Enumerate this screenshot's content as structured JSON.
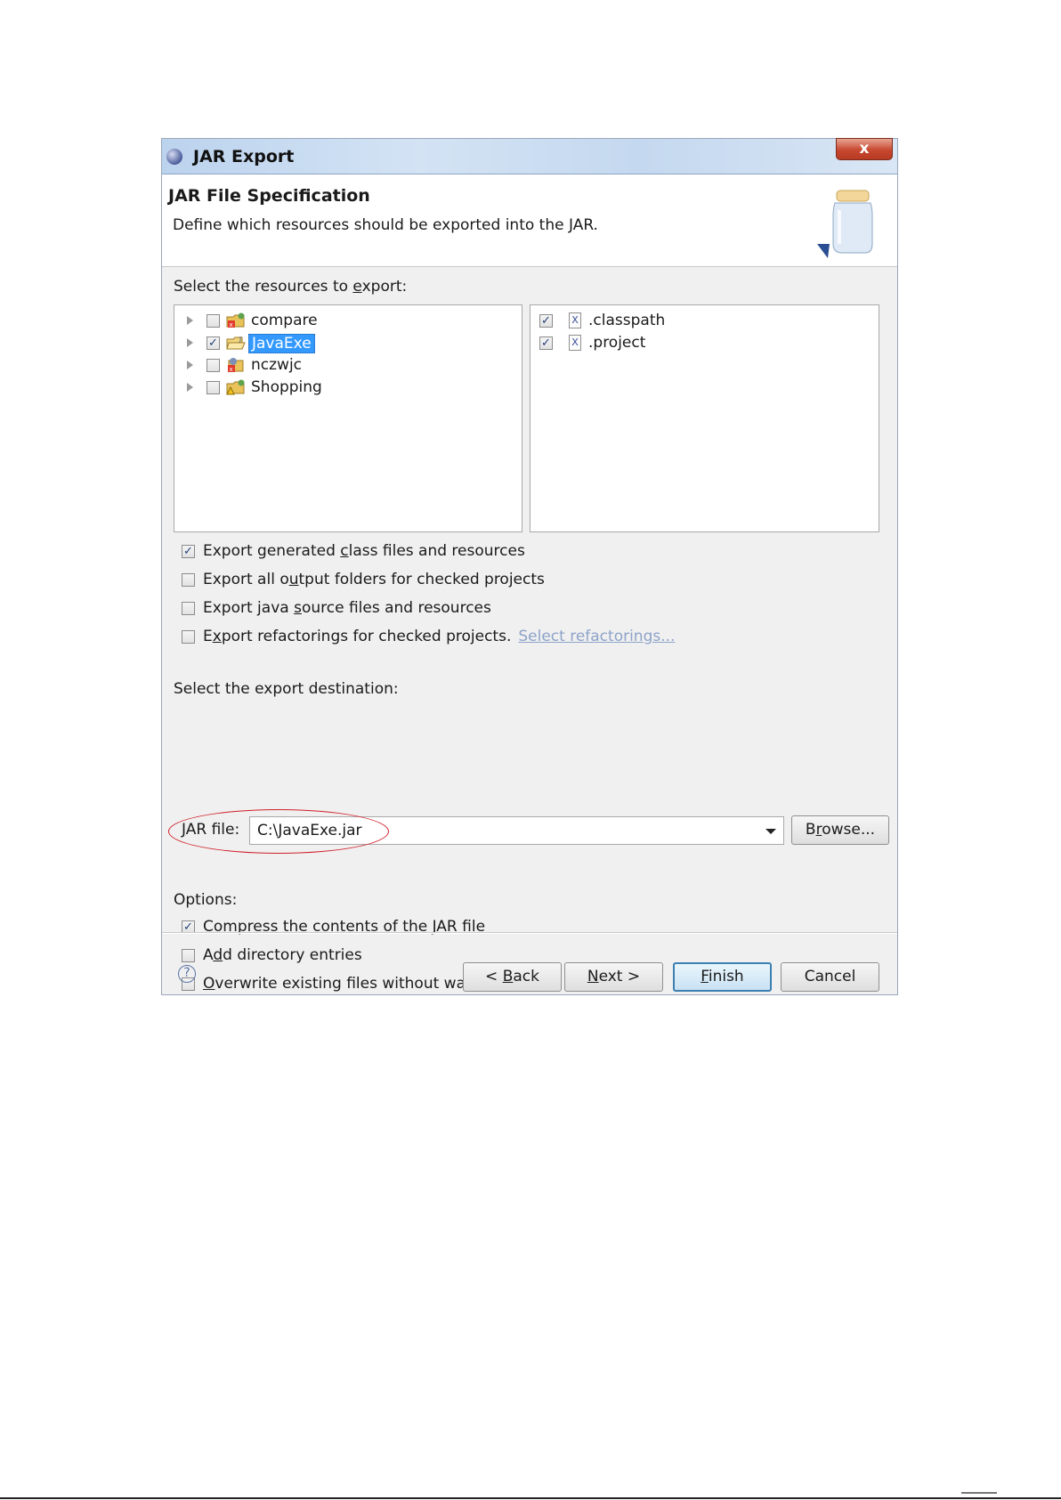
{
  "window": {
    "title": "JAR Export",
    "close_label": "x"
  },
  "header": {
    "title": "JAR File Specification",
    "description": "Define which resources should be exported into the JAR."
  },
  "resources": {
    "label": "Select the resources to export:",
    "projects": [
      {
        "name": "compare",
        "checked": false,
        "selected": false,
        "icon": "project-error-icon"
      },
      {
        "name": "JavaExe",
        "checked": true,
        "selected": true,
        "icon": "project-open-icon"
      },
      {
        "name": "nczwjc",
        "checked": false,
        "selected": false,
        "icon": "project-error-icon"
      },
      {
        "name": "Shopping",
        "checked": false,
        "selected": false,
        "icon": "project-warning-icon"
      }
    ],
    "files": [
      {
        "name": ".classpath",
        "checked": true,
        "icon": "xml-file-icon"
      },
      {
        "name": ".project",
        "checked": true,
        "icon": "xml-file-icon"
      }
    ]
  },
  "export_options": [
    {
      "pre": "Export generated ",
      "mn": "c",
      "post": "lass files and resources",
      "checked": true
    },
    {
      "pre": "Export all o",
      "mn": "u",
      "post": "tput folders for checked projects",
      "checked": false
    },
    {
      "pre": "Export java ",
      "mn": "s",
      "post": "ource files and resources",
      "checked": false
    },
    {
      "pre": "E",
      "mn": "x",
      "post": "port refactorings for checked projects.",
      "checked": false,
      "link": "Select refactorings..."
    }
  ],
  "destination": {
    "label": "Select the export destination:",
    "jar_label_mn": "J",
    "jar_label_rest": "AR file:",
    "jar_value": "C:\\JavaExe.jar",
    "browse_pre": "B",
    "browse_mn": "r",
    "browse_post": "owse..."
  },
  "options": {
    "label": "Options:",
    "items": [
      {
        "pre": "Com",
        "mn": "p",
        "post": "ress the contents of the JAR file",
        "checked": true
      },
      {
        "pre": "A",
        "mn": "d",
        "post": "d directory entries",
        "checked": false
      },
      {
        "pre": "",
        "mn": "O",
        "post": "verwrite existing files without warning",
        "checked": false
      }
    ]
  },
  "buttons": {
    "back_pre": "< ",
    "back_mn": "B",
    "back_post": "ack",
    "next_mn": "N",
    "next_post": "ext >",
    "finish_mn": "F",
    "finish_post": "inish",
    "cancel": "Cancel"
  },
  "colors": {
    "annotation": "#d0202b",
    "selection": "#3399ff",
    "link": "#8ea3c9"
  }
}
